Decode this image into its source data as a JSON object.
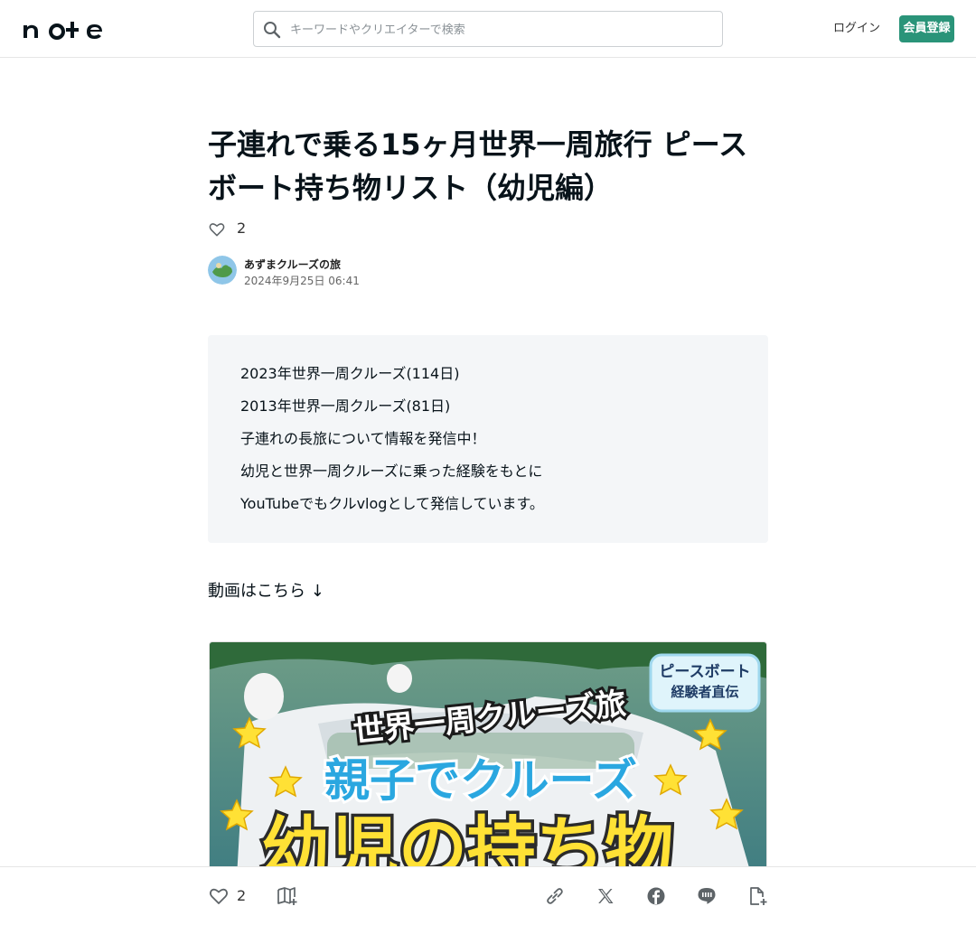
{
  "header": {
    "logo_text": "note",
    "search_placeholder": "キーワードやクリエイターで検索",
    "login_label": "ログイン",
    "signup_label": "会員登録"
  },
  "article": {
    "title": "子連れで乗る15ヶ月世界一周旅行 ピースボート持ち物リスト（幼児編）",
    "like_count": "2",
    "author_name": "あずまクルーズの旅",
    "date": "2024年9月25日 06:41",
    "profile_lines": [
      "2023年世界一周クルーズ(114日)",
      "2013年世界一周クルーズ(81日)",
      "子連れの長旅について情報を発信中！",
      "幼児と世界一周クルーズに乗った経験をもとに",
      "YouTubeでもクルvlogとして発信しています。"
    ],
    "lead_text": "動画はこちら ↓",
    "thumbnail_lines": {
      "badge_line1": "ピースボート",
      "badge_line2": "経験者直伝",
      "arc_text": "世界一周クルーズ旅",
      "middle_text": "親子でクルーズ",
      "big_text": "幼児の持ち物"
    }
  },
  "bottom_bar": {
    "like_count": "2"
  },
  "colors": {
    "brand_green": "#2a9479",
    "profile_bg": "#f4f6f8",
    "text": "#08131a"
  },
  "icons": [
    "search-icon",
    "heart-icon",
    "magazine-add-icon",
    "link-icon",
    "x-icon",
    "facebook-icon",
    "line-icon",
    "embed-icon"
  ]
}
